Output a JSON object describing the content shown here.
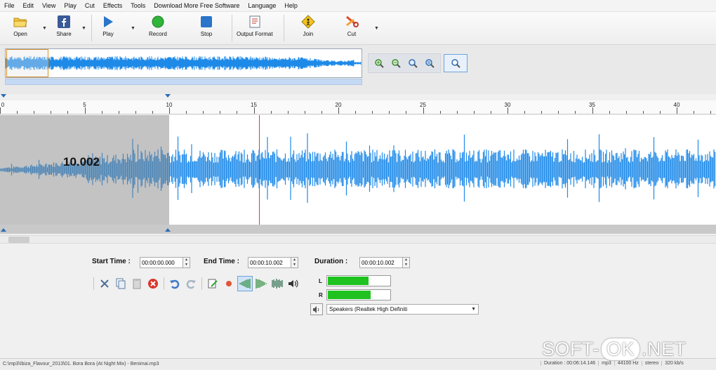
{
  "menu": [
    "File",
    "Edit",
    "View",
    "Play",
    "Cut",
    "Effects",
    "Tools",
    "Download More Free Software",
    "Language",
    "Help"
  ],
  "toolbar": {
    "open_label": "Open",
    "share_label": "Share",
    "play_label": "Play",
    "record_label": "Record",
    "stop_label": "Stop",
    "output_label": "Output Format",
    "join_label": "Join",
    "cut_label": "Cut"
  },
  "icons": {
    "open": "folder-icon",
    "share": "facebook-icon",
    "play": "play-icon",
    "record": "record-icon",
    "stop": "stop-icon",
    "output": "document-icon",
    "join": "join-sign-icon",
    "cut": "scissors-icon"
  },
  "ruler": {
    "labels": [
      "0",
      "5",
      "10",
      "15",
      "20",
      "25",
      "30",
      "35",
      "40"
    ]
  },
  "waveform": {
    "selection_label": "10.002",
    "wave_color": "#1e8ae8",
    "cursor_color": "#e33a2e"
  },
  "times": {
    "start_label": "Start Time :",
    "start_value": "00:00:00.000",
    "end_label": "End Time :",
    "end_value": "00:00:10.002",
    "duration_label": "Duration :",
    "duration_value": "00:00:10.002"
  },
  "meters": {
    "left_label": "L",
    "right_label": "R",
    "left_level": 0.64,
    "right_level": 0.68
  },
  "device": {
    "selected": "Speakers (Realtek High Definiti"
  },
  "status": {
    "path": "C:\\mp3\\Ibiza_Flavour_2013\\01. Bora Bora (At Night Mix) - Benimai.mp3",
    "duration": "Duration : 00:06:14.146",
    "format": "mp3",
    "samplerate": "44100 Hz",
    "channels": "stereo",
    "bitrate": "320 kb/s"
  },
  "watermark": {
    "left": "SOFT-",
    "middle": "OK",
    "right": ".NET"
  }
}
